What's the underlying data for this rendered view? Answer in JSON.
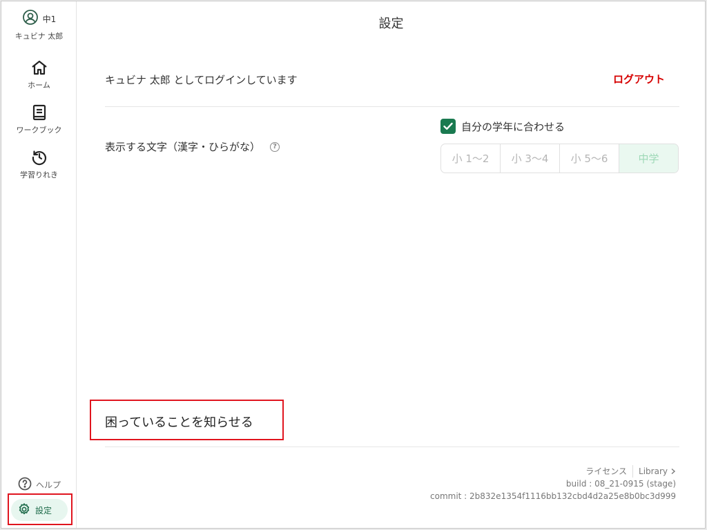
{
  "sidebar": {
    "profile": {
      "grade": "中1",
      "name": "キュビナ 太郎"
    },
    "nav": [
      {
        "label": "ホーム",
        "icon": "home-icon"
      },
      {
        "label": "ワークブック",
        "icon": "book-icon"
      },
      {
        "label": "学習りれき",
        "icon": "history-icon"
      }
    ],
    "help_label": "ヘルプ",
    "settings_label": "設定"
  },
  "main": {
    "title": "設定",
    "login_text": "キュビナ 太郎 としてログインしています",
    "logout_label": "ログアウト",
    "display_label": "表示する文字（漢字・ひらがな）",
    "match_grade_label": "自分の学年に合わせる",
    "match_grade_checked": true,
    "grade_options": [
      "小 1〜2",
      "小 3〜4",
      "小 5〜6",
      "中学"
    ],
    "selected_grade": "中学",
    "report_label": "困っていることを知らせる"
  },
  "footer": {
    "license_label": "ライセンス",
    "library_label": "Library",
    "build": "build : 08_21-0915 (stage)",
    "commit": "commit : 2b832e1354f1116bb132cbd4d2a25e8b0bc3d999"
  },
  "colors": {
    "accent_green": "#1a7a50",
    "logout_red": "#d60000",
    "highlight_red": "#e0141e"
  }
}
